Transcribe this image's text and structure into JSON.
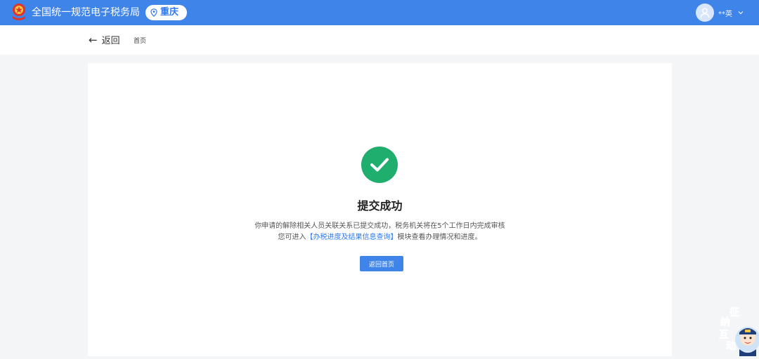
{
  "header": {
    "title": "全国统一规范电子税务局",
    "region": "重庆",
    "username": "**英"
  },
  "subnav": {
    "back_label": "返回",
    "breadcrumb_home": "首页"
  },
  "result": {
    "title": "提交成功",
    "message_line1": "你申请的解除相关人员关联关系已提交成功，税务机关将在5个工作日内完成审核",
    "message_line2_prefix": "您可进入",
    "message_line2_link": "【办税进度及结果信息查询】",
    "message_line2_suffix": "模块查看办理情况和进度。",
    "button_label": "返回首页"
  },
  "mascot": {
    "char1": "征",
    "char2": "纳",
    "char3": "互",
    "char4": "动"
  },
  "colors": {
    "brand": "#3f84e9",
    "success": "#1fae6d",
    "link": "#2e78ee"
  }
}
